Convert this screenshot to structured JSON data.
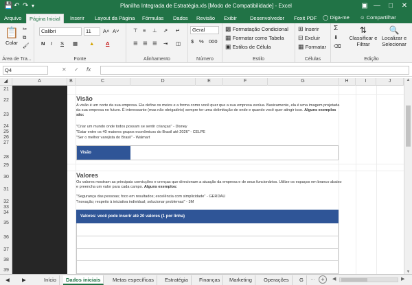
{
  "titlebar": {
    "title": "Planilha Integrada de Estratégia.xls  [Modo de Compatibilidade] - Excel",
    "save_icon": "save-icon",
    "undo_icon": "undo-icon",
    "redo_icon": "redo-icon",
    "colors": {
      "brand": "#217346"
    }
  },
  "tabs": {
    "items": [
      "Arquivo",
      "Página Inicial",
      "Inserir",
      "Layout da Página",
      "Fórmulas",
      "Dados",
      "Revisão",
      "Exibir",
      "Desenvolvedor",
      "Foxit PDF"
    ],
    "tell_me": "Diga-me",
    "share": "Compartilhar"
  },
  "ribbon": {
    "clipboard": {
      "paste": "Colar",
      "label": "Área de Tra..."
    },
    "font": {
      "name": "Calibri",
      "size": "11",
      "bold": "N",
      "italic": "I",
      "underline": "S",
      "label": "Fonte"
    },
    "alignment": {
      "label": "Alinhamento"
    },
    "number": {
      "format": "Geral",
      "label": "Número"
    },
    "styles": {
      "conditional": "Formatação Condicional",
      "table": "Formatar como Tabela",
      "cell": "Estilos de Célula",
      "label": "Estilo"
    },
    "cells": {
      "insert": "Inserir",
      "delete": "Excluir",
      "format": "Formatar",
      "label": "Células"
    },
    "editing": {
      "sort": "Classificar e Filtrar",
      "find": "Localizar e Selecionar",
      "label": "Edição"
    }
  },
  "formula": {
    "namebox": "Q4",
    "fx": "fx"
  },
  "columns": [
    "A",
    "B",
    "C",
    "D",
    "E",
    "F",
    "G",
    "H",
    "I",
    "J"
  ],
  "rows": [
    "21",
    "22",
    "23",
    "24",
    "25",
    "26",
    "27",
    "28",
    "29",
    "30",
    "31",
    "32",
    "33",
    "34",
    "35",
    "36",
    "37",
    "38",
    "39"
  ],
  "content": {
    "visao_heading": "Visão",
    "visao_text": "A visão é um norte da sua empresa. Ela define os meios e a forma como você quer que a sua empresa evolua. Basicamente, ela é uma imagem projetada da sua empresa no futuro. É interessante (mas não obrigatório) sempre ter uma delimitação de onde e quando você quer atingir isso.",
    "visao_examples_label": "Alguns exemplos são:",
    "visao_ex1": "\"Criar um mundo onde todos possam se sentir crianças\" - Disney",
    "visao_ex2": "\"Estar entre os 40 maiores grupos econômicos do Brasil até 2026\" - CELPE",
    "visao_ex3": "\"Ser o melhor varejista do Brasil\" - Walmart",
    "visao_box_label": "Visão",
    "valores_heading": "Valores",
    "valores_text": "Os valores mostram as principais convicções e crenças que direcionam a atuação da empresa e de seus funcionários. Utilize os espaços em branco abaixo e preencha um valor para cada campo.",
    "valores_examples_label": "Alguns exemplos:",
    "valores_ex1": "\"Segurança das pessoas; foco em resultados; excelência com simplicidade\" - GERDAU",
    "valores_ex2": "\"Inovação; respeito à iniciativa individual; solucionar problemas\" - 3M",
    "valores_box_header": "Valores: você pode inserir até 20 valores (1 por linha)"
  },
  "sheettabs": {
    "items": [
      "Início",
      "Dados iniciais",
      "Metas específicas",
      "Estratégia",
      "Finanças",
      "Marketing",
      "Operações",
      "G"
    ],
    "active": "Dados iniciais"
  }
}
